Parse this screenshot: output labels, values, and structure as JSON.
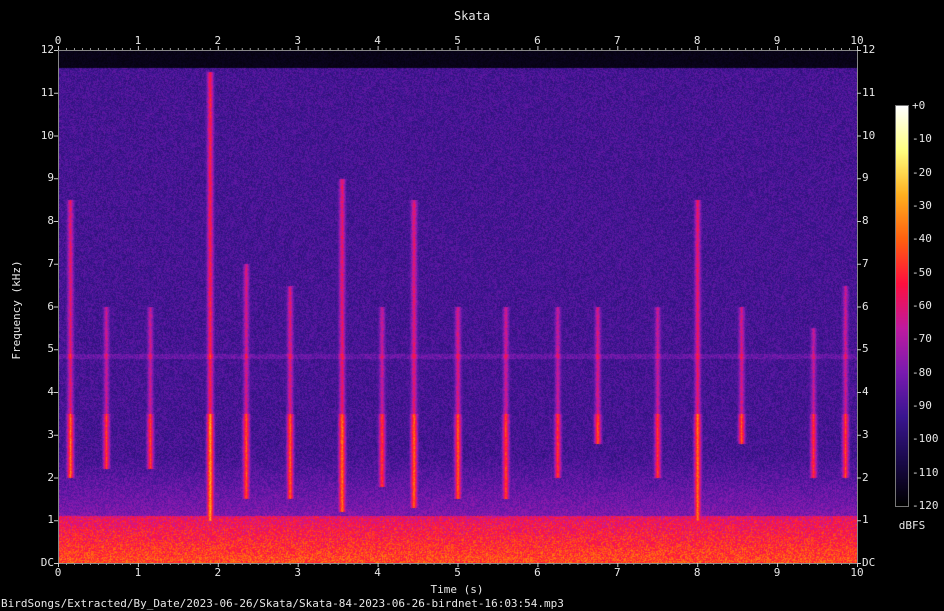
{
  "chart_data": {
    "type": "heatmap",
    "title": "Skata",
    "xlabel": "Time (s)",
    "ylabel": "Frequency (kHz)",
    "xlim": [
      0,
      10
    ],
    "ylim": [
      0,
      12
    ],
    "x_ticks": [
      "0",
      "1",
      "2",
      "3",
      "4",
      "5",
      "6",
      "7",
      "8",
      "9",
      "10"
    ],
    "y_ticks": [
      "DC",
      "1",
      "2",
      "3",
      "4",
      "5",
      "6",
      "7",
      "8",
      "9",
      "10",
      "11",
      "12"
    ],
    "colorbar": {
      "unit": "dBFS",
      "range": [
        -120,
        0
      ],
      "ticks": [
        "+0",
        "-10",
        "-20",
        "-30",
        "-40",
        "-50",
        "-60",
        "-70",
        "-80",
        "-90",
        "-100",
        "-110",
        "-120"
      ]
    },
    "colormap": [
      "#000000",
      "#1a0a4a",
      "#3a1590",
      "#7a1ab0",
      "#c01aa0",
      "#ff1040",
      "#ff6010",
      "#ffb020",
      "#ffff80",
      "#ffffff"
    ],
    "calls": [
      {
        "t": 0.15,
        "f_low": 2.0,
        "f_high": 8.5,
        "strength": 0.8
      },
      {
        "t": 0.6,
        "f_low": 2.2,
        "f_high": 6.0,
        "strength": 0.6
      },
      {
        "t": 1.15,
        "f_low": 2.2,
        "f_high": 6.0,
        "strength": 0.6
      },
      {
        "t": 1.9,
        "f_low": 1.0,
        "f_high": 11.5,
        "strength": 1.0
      },
      {
        "t": 2.35,
        "f_low": 1.5,
        "f_high": 7.0,
        "strength": 0.7
      },
      {
        "t": 2.9,
        "f_low": 1.5,
        "f_high": 6.5,
        "strength": 0.75
      },
      {
        "t": 3.55,
        "f_low": 1.2,
        "f_high": 9.0,
        "strength": 0.85
      },
      {
        "t": 4.05,
        "f_low": 1.8,
        "f_high": 6.0,
        "strength": 0.6
      },
      {
        "t": 4.45,
        "f_low": 1.3,
        "f_high": 8.5,
        "strength": 0.8
      },
      {
        "t": 5.0,
        "f_low": 1.5,
        "f_high": 6.0,
        "strength": 0.75
      },
      {
        "t": 5.6,
        "f_low": 1.5,
        "f_high": 6.0,
        "strength": 0.65
      },
      {
        "t": 6.25,
        "f_low": 2.0,
        "f_high": 6.0,
        "strength": 0.6
      },
      {
        "t": 6.75,
        "f_low": 2.8,
        "f_high": 6.0,
        "strength": 0.7
      },
      {
        "t": 7.5,
        "f_low": 2.0,
        "f_high": 6.0,
        "strength": 0.6
      },
      {
        "t": 8.0,
        "f_low": 1.0,
        "f_high": 8.5,
        "strength": 0.85
      },
      {
        "t": 8.55,
        "f_low": 2.8,
        "f_high": 6.0,
        "strength": 0.7
      },
      {
        "t": 9.45,
        "f_low": 2.0,
        "f_high": 5.5,
        "strength": 0.55
      },
      {
        "t": 9.85,
        "f_low": 2.0,
        "f_high": 6.5,
        "strength": 0.6
      }
    ],
    "harmonic_band_khz": 4.85,
    "noise_floor_khz": 1.1,
    "cutoff_khz": 11.6
  },
  "footer": {
    "filename": "BirdSongs/Extracted/By_Date/2023-06-26/Skata/Skata-84-2023-06-26-birdnet-16:03:54.mp3"
  }
}
